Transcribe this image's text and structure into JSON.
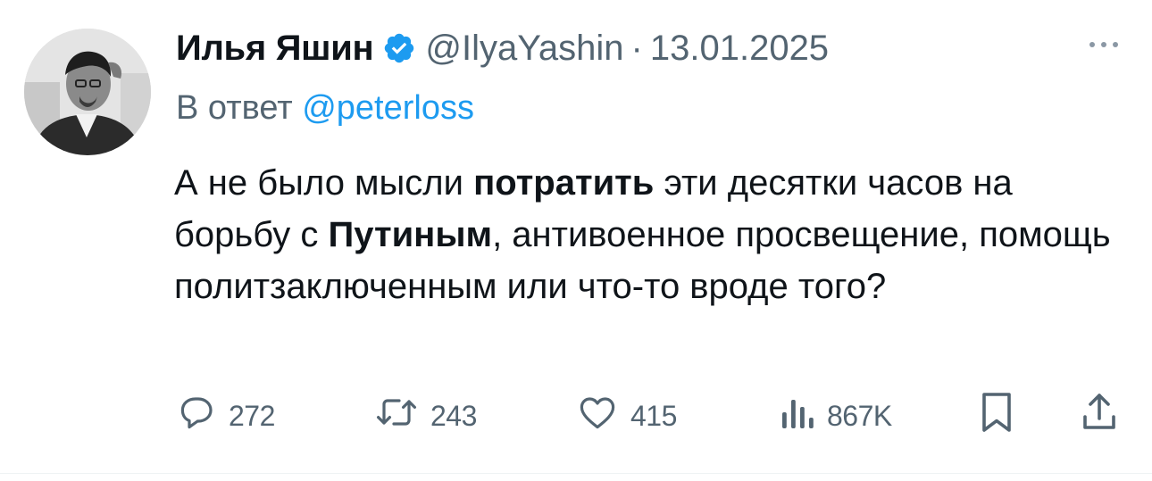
{
  "author": {
    "name": "Илья Яшин",
    "handle": "@IlyaYashin",
    "separator": "·",
    "date": "13.01.2025",
    "verified": true
  },
  "reply_to": {
    "prefix": "В ответ",
    "mention": "@peterloss"
  },
  "tweet_text": {
    "p1": "А не было мысли ",
    "b1": "потратить",
    "p2": " эти десятки часов на борьбу с ",
    "b2": "Путиным",
    "p3": ", антивоенное просвещение, помощь политзаключенным или что-то вроде того?"
  },
  "actions": {
    "replies": "272",
    "reposts": "243",
    "likes": "415",
    "views": "867K"
  },
  "icons": {
    "more": "more-icon",
    "verified": "verified-badge-icon",
    "reply": "reply-icon",
    "repost": "repost-icon",
    "like": "like-icon",
    "views": "views-icon",
    "bookmark": "bookmark-icon",
    "share": "share-icon"
  },
  "colors": {
    "accent": "#1d9bf0",
    "secondary_text": "#536471",
    "primary_text": "#0f1419"
  }
}
